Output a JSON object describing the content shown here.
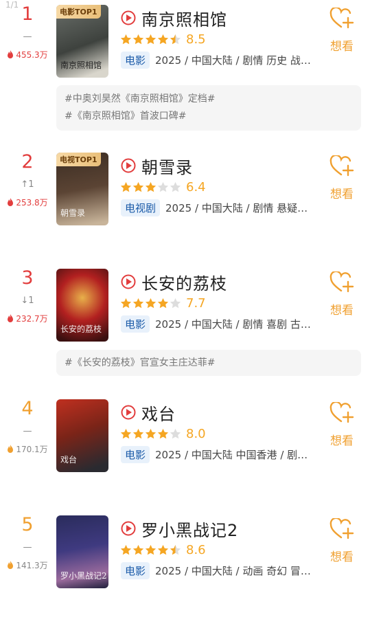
{
  "page_counter": "1/1",
  "colors": {
    "accent": "#f5a623",
    "rank_top": "#e23d3d",
    "rank_other": "#f0a030",
    "tag_bg": "#e8f1fb",
    "tag_fg": "#1a5aa8"
  },
  "want_label": "想看",
  "items": [
    {
      "rank": "1",
      "change": "—",
      "heat": "455.3万",
      "badge": "电影TOP1",
      "poster_text": "南京照相馆",
      "title": "南京照相馆",
      "stars": "4.5",
      "score": "8.5",
      "type": "电影",
      "meta": "2025 / 中国大陆 / 剧情 历史 战…",
      "topics": [
        "#中奥刘昊然《南京照相馆》定档#",
        "#《南京照相馆》首波口碑#"
      ]
    },
    {
      "rank": "2",
      "change": "↑1",
      "heat": "253.8万",
      "badge": "电视TOP1",
      "poster_text": "朝雪录",
      "title": "朝雪录",
      "stars": "3",
      "score": "6.4",
      "type": "电视剧",
      "meta": "2025 / 中国大陆 / 剧情 悬疑…",
      "topics": []
    },
    {
      "rank": "3",
      "change": "↓1",
      "heat": "232.7万",
      "badge": "",
      "poster_text": "长安的荔枝",
      "title": "长安的荔枝",
      "stars": "4",
      "score": "7.7",
      "type": "电影",
      "meta": "2025 / 中国大陆 / 剧情 喜剧 古…",
      "topics": [
        "#《长安的荔枝》官宣女主庄达菲#"
      ]
    },
    {
      "rank": "4",
      "change": "—",
      "heat": "170.1万",
      "badge": "",
      "poster_text": "戏台",
      "title": "戏台",
      "stars": "4",
      "score": "8.0",
      "type": "电影",
      "meta": "2025 / 中国大陆 中国香港 / 剧…",
      "topics": []
    },
    {
      "rank": "5",
      "change": "—",
      "heat": "141.3万",
      "badge": "",
      "poster_text": "罗小黑战记2",
      "title": "罗小黑战记2",
      "stars": "4.5",
      "score": "8.6",
      "type": "电影",
      "meta": "2025 / 中国大陆 / 动画 奇幻 冒…",
      "topics": []
    }
  ]
}
